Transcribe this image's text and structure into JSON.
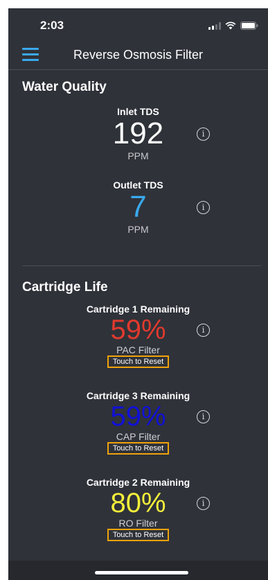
{
  "status_bar": {
    "time": "2:03"
  },
  "nav": {
    "title": "Reverse Osmosis Filter"
  },
  "water_quality": {
    "title": "Water Quality",
    "metrics": [
      {
        "label": "Inlet TDS",
        "value": "192",
        "unit": "PPM",
        "color": "#ffffff"
      },
      {
        "label": "Outlet TDS",
        "value": "7",
        "unit": "PPM",
        "color": "#3aa9ee"
      }
    ]
  },
  "cartridge_life": {
    "title": "Cartridge Life",
    "cartridges": [
      {
        "label": "Cartridge 1 Remaining",
        "value": "59%",
        "type": "PAC Filter",
        "reset": "Touch to Reset",
        "color": "#e03a2e"
      },
      {
        "label": "Cartridge 3 Remaining",
        "value": "59%",
        "type": "CAP Filter",
        "reset": "Touch to Reset",
        "color": "#1010d8"
      },
      {
        "label": "Cartridge 2 Remaining",
        "value": "80%",
        "type": "RO Filter",
        "reset": "Touch to Reset",
        "color": "#f5f03a"
      }
    ]
  },
  "icons": {
    "menu": "hamburger-icon",
    "info": "info-icon",
    "wifi": "wifi-icon",
    "battery": "battery-icon",
    "signal": "signal-icon"
  },
  "colors": {
    "background": "#2f3239",
    "accent": "#3aa9ee",
    "reset_border": "#f0a30a"
  }
}
